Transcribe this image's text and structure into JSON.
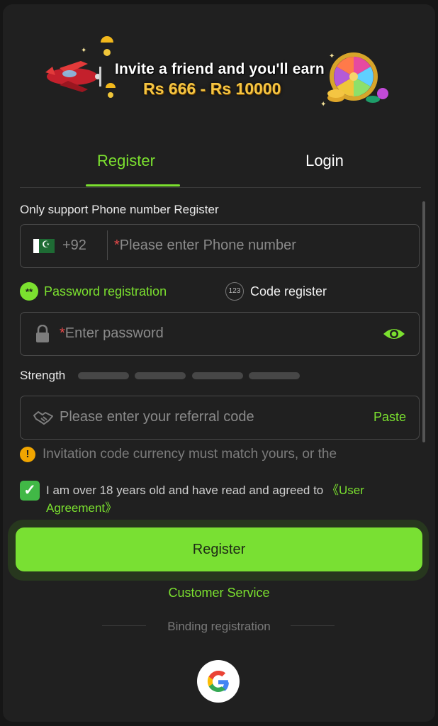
{
  "banner": {
    "line1": "Invite a friend and you'll earn",
    "line2": "Rs 666 - Rs 10000"
  },
  "tabs": [
    {
      "label": "Register",
      "active": true
    },
    {
      "label": "Login",
      "active": false
    }
  ],
  "form": {
    "hint": "Only support Phone number Register",
    "phone": {
      "country_code": "+92",
      "required_mark": "*",
      "placeholder": "Please enter Phone number",
      "flag": "pakistan-flag"
    },
    "modes": [
      {
        "label": "Password registration",
        "icon_text": "**",
        "selected": true
      },
      {
        "label": "Code register",
        "icon_text": "123",
        "selected": false
      }
    ],
    "password": {
      "required_mark": "*",
      "placeholder": "Enter password"
    },
    "strength": {
      "label": "Strength",
      "segments": 4,
      "filled": 0
    },
    "referral": {
      "placeholder": "Please enter your referral code",
      "paste_label": "Paste"
    },
    "notice": "Invitation code currency must match yours, or the",
    "agreement": {
      "checked": true,
      "text": "I am over 18 years old and have read and agreed to ",
      "link": "《User Agreement》"
    },
    "submit_label": "Register"
  },
  "customer_service": "Customer Service",
  "binding_label": "Binding registration",
  "social": [
    {
      "name": "google-icon"
    }
  ],
  "colors": {
    "accent": "#7be02f",
    "background": "#202020",
    "warning": "#f0a500",
    "checkbox": "#41b846"
  }
}
